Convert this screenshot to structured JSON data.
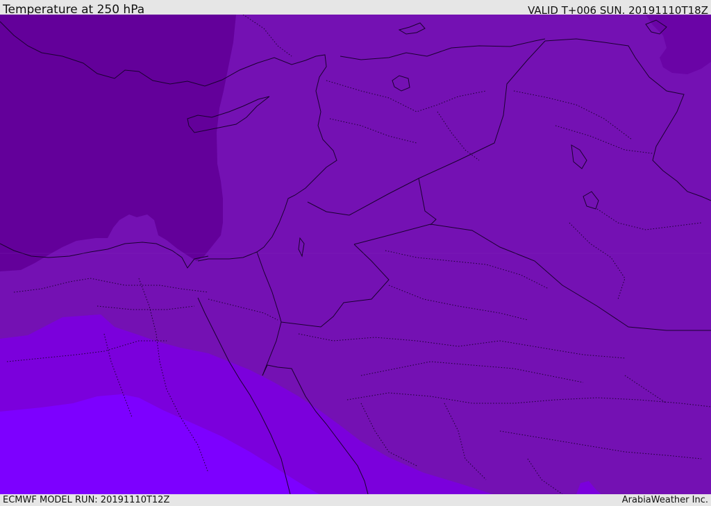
{
  "header": {
    "title": "Temperature at 250 hPa",
    "valid": "VALID T+006 SUN. 20191110T18Z"
  },
  "footer": {
    "model_run": "ECMWF MODEL RUN: 20191110T12Z",
    "credit": "ArabiaWeather Inc."
  },
  "colors": {
    "zone_cold": "#63009a",
    "zone_mid": "#7411b3",
    "zone_warm": "#7b00dc",
    "zone_warmest": "#7d00ff",
    "coastline": "#1a0030"
  }
}
